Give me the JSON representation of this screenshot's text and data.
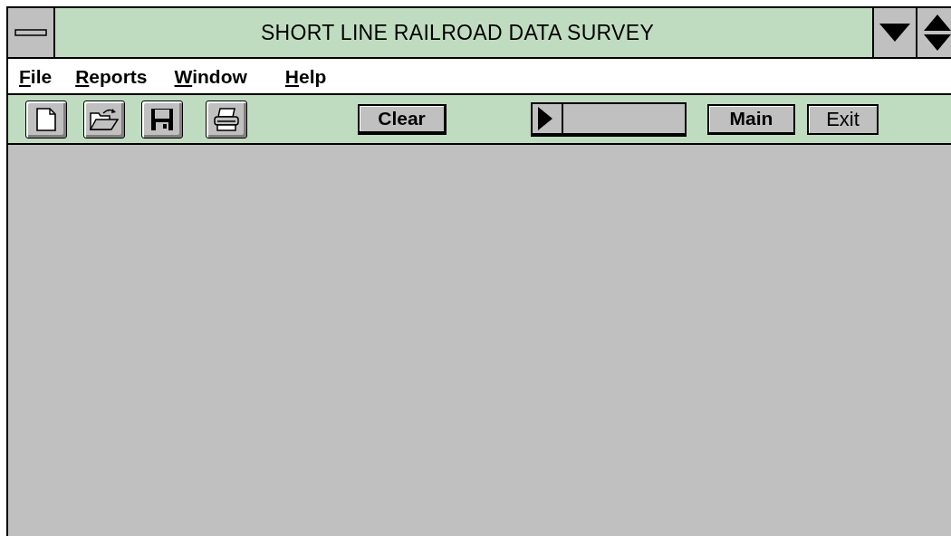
{
  "window": {
    "title": "SHORT LINE RAILROAD DATA SURVEY"
  },
  "menu": [
    {
      "label": "File"
    },
    {
      "label": "Reports"
    },
    {
      "label": "Window"
    },
    {
      "label": "Help"
    }
  ],
  "toolbar": {
    "tools": [
      {
        "kind": "new"
      },
      {
        "kind": "open"
      },
      {
        "kind": "save"
      },
      {
        "kind": "print"
      }
    ],
    "clear_button": "Clear",
    "buttons": [
      "Main",
      "Exit"
    ]
  }
}
